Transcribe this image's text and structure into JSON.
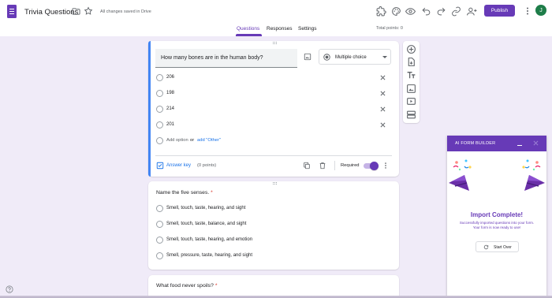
{
  "header": {
    "title": "Trivia Questions",
    "saved_status": "All changes saved in Drive",
    "publish_label": "Publish",
    "avatar_initial": "J"
  },
  "tabs": [
    "Questions",
    "Responses",
    "Settings"
  ],
  "active_tab": "Questions",
  "total_points": "Total points: 0",
  "active_question": {
    "title": "How many bones are in the human body?",
    "type": "Multiple choice",
    "options": [
      "206",
      "198",
      "214",
      "201"
    ],
    "add_option": "Add option",
    "or": "or",
    "add_other": "add \"Other\"",
    "answer_key": "Answer key",
    "points": "(0 points)",
    "required_label": "Required",
    "required": true
  },
  "question2": {
    "title": "Name the five senses.",
    "required_mark": "*",
    "options": [
      "Smell, touch, taste, hearing, and sight",
      "Smell, touch, taste, balance, and sight",
      "Smell, touch, taste, hearing, and emotion",
      "Smell, pressure, taste, hearing, and sight"
    ]
  },
  "question3": {
    "title": "What food never spoils?",
    "required_mark": "*"
  },
  "ai_panel": {
    "title": "AI FORM BUILDER",
    "heading": "Import Complete!",
    "line1": "Successfully imported questions into your form.",
    "line2": "Your form is now ready to use!",
    "start_over": "Start Over"
  },
  "colors": {
    "accent": "#673ab7",
    "background": "#f0ebf8",
    "link": "#1a73e8",
    "required": "#d93025"
  },
  "icons": [
    "forms-logo-icon",
    "folder-icon",
    "star-icon",
    "addon-icon",
    "palette-icon",
    "preview-eye-icon",
    "undo-icon",
    "redo-icon",
    "link-icon",
    "add-collaborator-icon",
    "more-vert-icon",
    "add-question-icon",
    "import-questions-icon",
    "add-title-icon",
    "add-image-icon",
    "add-video-icon",
    "add-section-icon",
    "help-icon"
  ]
}
